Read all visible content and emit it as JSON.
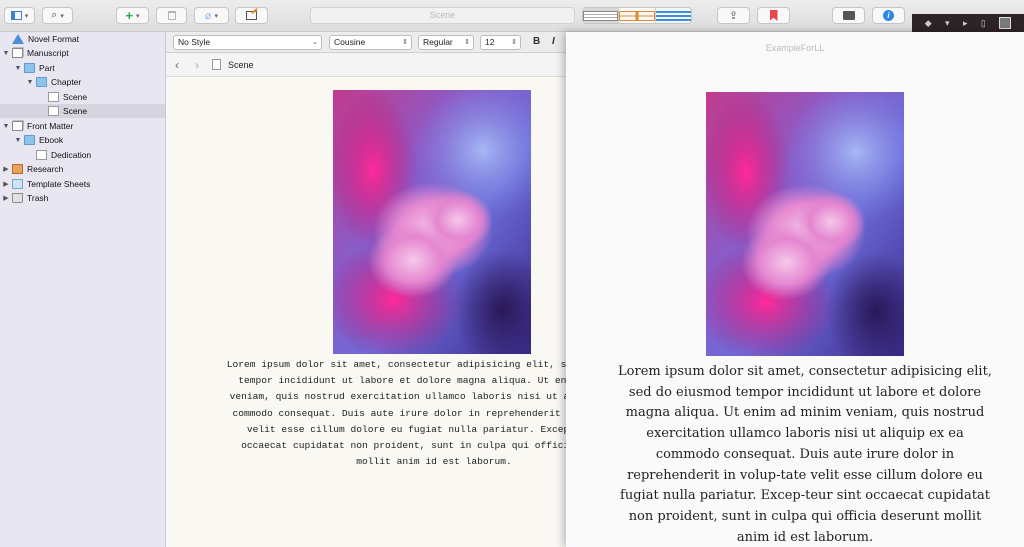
{
  "toolbar": {
    "search_placeholder": "Scene"
  },
  "sidebar": {
    "items": [
      {
        "label": "Novel Format",
        "icon": "novel-format-icon"
      },
      {
        "label": "Manuscript",
        "icon": "manuscript-icon"
      },
      {
        "label": "Part",
        "icon": "folder-icon"
      },
      {
        "label": "Chapter",
        "icon": "folder-icon"
      },
      {
        "label": "Scene",
        "icon": "document-icon"
      },
      {
        "label": "Scene",
        "icon": "document-icon",
        "selected": true
      },
      {
        "label": "Front Matter",
        "icon": "front-matter-icon"
      },
      {
        "label": "Ebook",
        "icon": "folder-icon"
      },
      {
        "label": "Dedication",
        "icon": "document-icon"
      },
      {
        "label": "Research",
        "icon": "research-icon"
      },
      {
        "label": "Template Sheets",
        "icon": "template-sheets-icon"
      },
      {
        "label": "Trash",
        "icon": "trash-icon"
      }
    ]
  },
  "formatbar": {
    "style": "No Style",
    "font": "Cousine",
    "weight": "Regular",
    "size": "12",
    "bold": "B",
    "italic": "I"
  },
  "header": {
    "doc_title": "Scene"
  },
  "editor": {
    "text": "Lorem ipsum dolor sit amet, consectetur adipisicing elit, sed do eiusmod tempor incididunt ut labore et dolore magna aliqua. Ut enim ad minim veniam, quis nostrud exercitation ullamco laboris nisi ut aliquip ex ea commodo consequat. Duis aute irure dolor in reprehenderit in voluptate velit esse cillum dolore eu fugiat nulla pariatur. Excepteur sint occaecat cupidatat non proident, sunt in culpa qui officia deserunt mollit anim id est laborum."
  },
  "preview": {
    "title": "ExampleForLL",
    "text": "Lorem ipsum dolor sit amet, consectetur adipisicing elit, sed do eiusmod tempor incididunt ut labore et dolore magna aliqua. Ut enim ad minim veniam, quis nostrud exercitation ullamco laboris nisi ut aliquip ex ea commodo consequat. Duis aute irure dolor in reprehenderit in volup-tate velit esse cillum dolore eu fugiat nulla pariatur. Excep-teur sint occaecat cupidatat non proident, sunt in culpa qui officia deserunt mollit anim id est laborum."
  }
}
